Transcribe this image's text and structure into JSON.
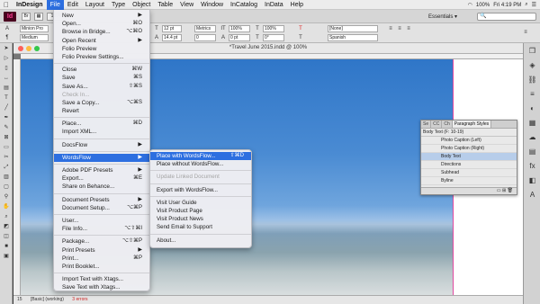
{
  "menubar": {
    "app_name": "InDesign",
    "items": [
      "File",
      "Edit",
      "Layout",
      "Type",
      "Object",
      "Table",
      "View",
      "Window",
      "InCatalog",
      "InData",
      "Help"
    ],
    "active": "File",
    "right": [
      "100%",
      "Fri 4:19 PM"
    ]
  },
  "appbar": {
    "logo": "Id",
    "zoom": "100%",
    "workspace": "Essentials ▾",
    "search_placeholder": "🔍"
  },
  "control": {
    "font_family": "Minion Pro",
    "font_style": "Medium",
    "size_a": "12 pt",
    "size_b": "14.4 pt",
    "kern": "Metrics",
    "tracking": "0",
    "scale_v": "100%",
    "scale_h": "100%",
    "skew": "0°",
    "baseline": "0 pt",
    "char_style": "[None]",
    "language": "Spanish"
  },
  "document": {
    "title": "*Travel June 2015.indd @ 100%",
    "status_page": "15",
    "status_style": "[Basic] (working)",
    "status_errors": "3 errors"
  },
  "file_menu": {
    "items": [
      {
        "label": "New",
        "shortcut": "",
        "arrow": "▶",
        "state": "normal"
      },
      {
        "label": "Open...",
        "shortcut": "⌘O",
        "arrow": "",
        "state": "normal"
      },
      {
        "label": "Browse in Bridge...",
        "shortcut": "⌥⌘O",
        "arrow": "",
        "state": "normal"
      },
      {
        "label": "Open Recent",
        "shortcut": "",
        "arrow": "▶",
        "state": "normal"
      },
      {
        "label": "Folio Preview",
        "shortcut": "",
        "arrow": "",
        "state": "normal"
      },
      {
        "label": "Folio Preview Settings...",
        "shortcut": "",
        "arrow": "",
        "state": "normal"
      },
      {
        "sep": true
      },
      {
        "label": "Close",
        "shortcut": "⌘W",
        "arrow": "",
        "state": "normal"
      },
      {
        "label": "Save",
        "shortcut": "⌘S",
        "arrow": "",
        "state": "normal"
      },
      {
        "label": "Save As...",
        "shortcut": "⇧⌘S",
        "arrow": "",
        "state": "normal"
      },
      {
        "label": "Check In...",
        "shortcut": "",
        "arrow": "",
        "state": "disabled"
      },
      {
        "label": "Save a Copy...",
        "shortcut": "⌥⌘S",
        "arrow": "",
        "state": "normal"
      },
      {
        "label": "Revert",
        "shortcut": "",
        "arrow": "",
        "state": "normal"
      },
      {
        "sep": true
      },
      {
        "label": "Place...",
        "shortcut": "⌘D",
        "arrow": "",
        "state": "normal"
      },
      {
        "label": "Import XML...",
        "shortcut": "",
        "arrow": "",
        "state": "normal"
      },
      {
        "sep": true
      },
      {
        "label": "DocsFlow",
        "shortcut": "",
        "arrow": "▶",
        "state": "normal"
      },
      {
        "sep": true
      },
      {
        "label": "WordsFlow",
        "shortcut": "",
        "arrow": "▶",
        "state": "highlighted"
      },
      {
        "sep": true
      },
      {
        "label": "Adobe PDF Presets",
        "shortcut": "",
        "arrow": "▶",
        "state": "normal"
      },
      {
        "label": "Export...",
        "shortcut": "⌘E",
        "arrow": "",
        "state": "normal"
      },
      {
        "label": "Share on Behance...",
        "shortcut": "",
        "arrow": "",
        "state": "normal"
      },
      {
        "sep": true
      },
      {
        "label": "Document Presets",
        "shortcut": "",
        "arrow": "▶",
        "state": "normal"
      },
      {
        "label": "Document Setup...",
        "shortcut": "⌥⌘P",
        "arrow": "",
        "state": "normal"
      },
      {
        "sep": true
      },
      {
        "label": "User...",
        "shortcut": "",
        "arrow": "",
        "state": "normal"
      },
      {
        "label": "File Info...",
        "shortcut": "⌥⇧⌘I",
        "arrow": "",
        "state": "normal"
      },
      {
        "sep": true
      },
      {
        "label": "Package...",
        "shortcut": "⌥⇧⌘P",
        "arrow": "",
        "state": "normal"
      },
      {
        "label": "Print Presets",
        "shortcut": "",
        "arrow": "▶",
        "state": "normal"
      },
      {
        "label": "Print...",
        "shortcut": "⌘P",
        "arrow": "",
        "state": "normal"
      },
      {
        "label": "Print Booklet...",
        "shortcut": "",
        "arrow": "",
        "state": "normal"
      },
      {
        "sep": true
      },
      {
        "label": "Import Text with Xtags...",
        "shortcut": "",
        "arrow": "",
        "state": "normal"
      },
      {
        "label": "Save Text with Xtags...",
        "shortcut": "",
        "arrow": "",
        "state": "normal"
      }
    ]
  },
  "wordsflow_menu": {
    "items": [
      {
        "label": "Place with WordsFlow...",
        "shortcut": "⇧⌘D",
        "state": "highlighted"
      },
      {
        "label": "Place without WordsFlow...",
        "shortcut": "",
        "state": "normal"
      },
      {
        "sep": true
      },
      {
        "label": "Update Linked Document",
        "shortcut": "",
        "state": "disabled"
      },
      {
        "sep": true
      },
      {
        "label": "Export with WordsFlow...",
        "shortcut": "",
        "state": "normal"
      },
      {
        "sep": true
      },
      {
        "label": "Visit User Guide",
        "shortcut": "",
        "state": "normal"
      },
      {
        "label": "Visit Product Page",
        "shortcut": "",
        "state": "normal"
      },
      {
        "label": "Visit Product News",
        "shortcut": "",
        "state": "normal"
      },
      {
        "label": "Send Email to Support",
        "shortcut": "",
        "state": "normal"
      },
      {
        "sep": true
      },
      {
        "label": "About...",
        "shortcut": "",
        "state": "normal"
      }
    ]
  },
  "paragraph_styles": {
    "tabs": [
      "Se",
      "CC",
      "Ch",
      "Paragraph Styles"
    ],
    "current": "Body Text (F: 10-19)",
    "styles": [
      "Photo Caption (Left)",
      "Photo Caption (Right)",
      "Body Text",
      "Directions",
      "Subhead",
      "Byline"
    ],
    "selected": "Body Text"
  },
  "colors": {
    "accent": "#2d6fe0",
    "indesign_pink": "#ff3f94"
  }
}
